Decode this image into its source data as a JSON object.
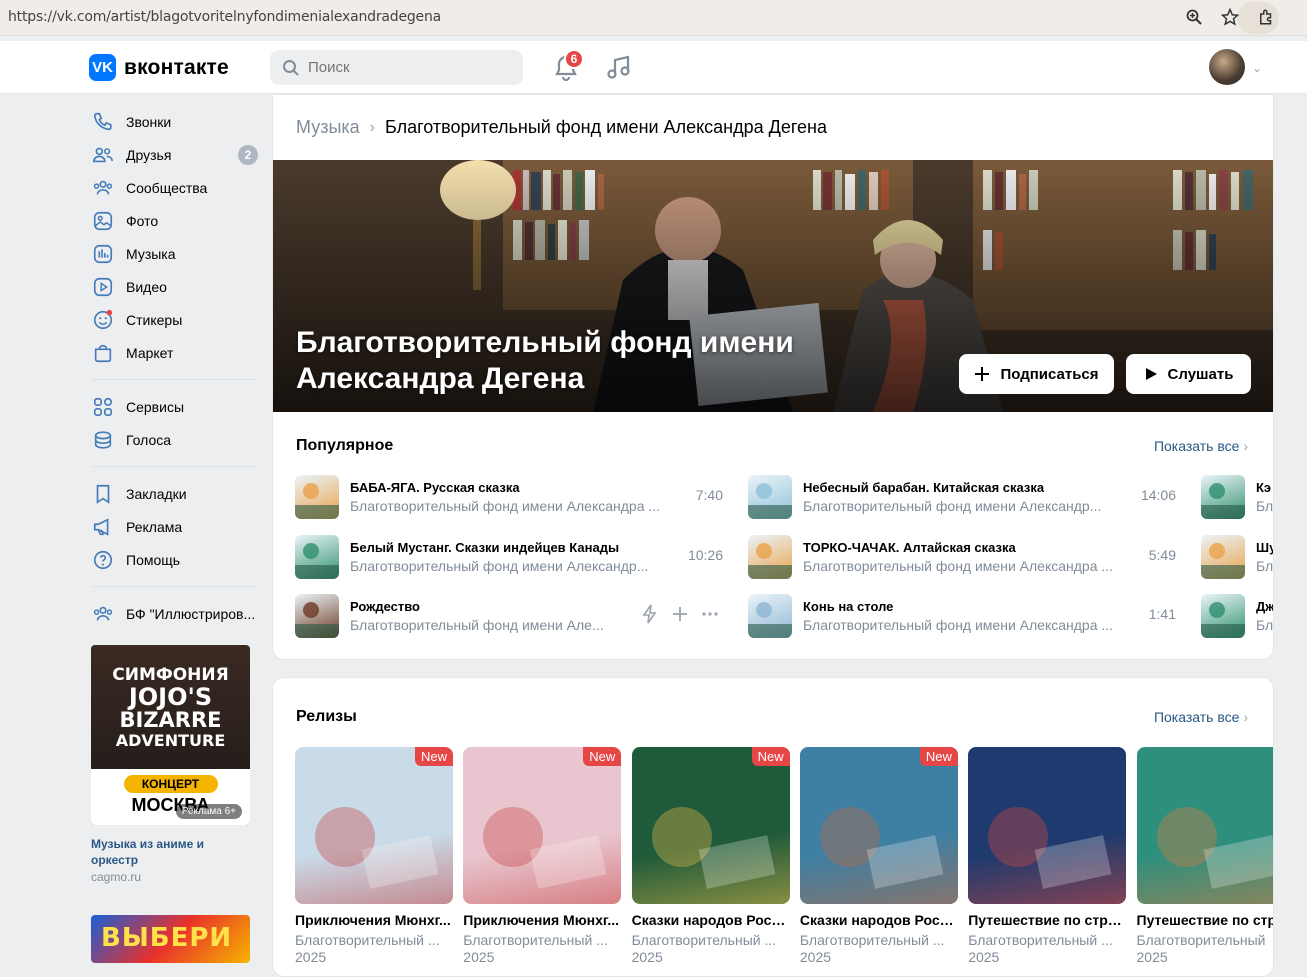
{
  "browser": {
    "url": "https://vk.com/artist/blagotvoritelnyfondimenialexandradegena"
  },
  "header": {
    "logo_text": "вконтакте",
    "search_placeholder": "Поиск",
    "notifications_count": "6"
  },
  "sidebar": {
    "items": [
      {
        "label": "Звонки",
        "icon": "phone-icon"
      },
      {
        "label": "Друзья",
        "icon": "friends-icon",
        "badge": "2"
      },
      {
        "label": "Сообщества",
        "icon": "communities-icon"
      },
      {
        "label": "Фото",
        "icon": "photo-icon"
      },
      {
        "label": "Музыка",
        "icon": "music-icon"
      },
      {
        "label": "Видео",
        "icon": "video-icon"
      },
      {
        "label": "Стикеры",
        "icon": "stickers-icon"
      },
      {
        "label": "Маркет",
        "icon": "market-icon"
      }
    ],
    "items2": [
      {
        "label": "Сервисы",
        "icon": "services-icon"
      },
      {
        "label": "Голоса",
        "icon": "votes-icon"
      }
    ],
    "items3": [
      {
        "label": "Закладки",
        "icon": "bookmark-icon"
      },
      {
        "label": "Реклама",
        "icon": "megaphone-icon"
      },
      {
        "label": "Помощь",
        "icon": "help-icon"
      }
    ],
    "group_label": "БФ \"Иллюстриров...",
    "ad1": {
      "line1": "СИМФОНИЯ",
      "line2": "JOJO'S",
      "line3": "BIZARRE",
      "line4": "ADVENTURE",
      "tag": "КОНЦЕРТ",
      "city": "МОСКВА",
      "label": "Реклама 6+",
      "text": "Музыка из аниме и оркестр",
      "url": "cagmo.ru"
    },
    "ad2_text": "ВЫБЕРИ"
  },
  "page": {
    "breadcrumb_root": "Музыка",
    "breadcrumb_current": "Благотворительный фонд имени Александра Дегена",
    "hero_title_line1": "Благотворительный фонд имени",
    "hero_title_line2": "Александра Дегена",
    "subscribe_label": "Подписаться",
    "listen_label": "Слушать"
  },
  "popular": {
    "title": "Популярное",
    "show_all": "Показать все",
    "tracks": [
      {
        "title": "БАБА-ЯГА. Русская сказка",
        "artist": "Благотворительный фонд имени Александра ...",
        "duration": "7:40",
        "color": "#e9a14a"
      },
      {
        "title": "Белый Мустанг. Сказки индейцев Канады",
        "artist": "Благотворительный фонд имени Александр...",
        "duration": "10:26",
        "color": "#2e8f6d"
      },
      {
        "title": "Рождество",
        "artist": "Благотворительный фонд имени Але...",
        "duration": "",
        "color": "#6b3a22"
      },
      {
        "title": "Небесный барабан. Китайская сказка",
        "artist": "Благотворительный фонд имени Александр...",
        "duration": "14:06",
        "color": "#8fc0d8"
      },
      {
        "title": "ТОРКО-ЧАЧАК. Алтайская сказка",
        "artist": "Благотворительный фонд имени Александра ...",
        "duration": "5:49",
        "color": "#e9a14a"
      },
      {
        "title": "Конь на столе",
        "artist": "Благотворительный фонд имени Александра ...",
        "duration": "1:41",
        "color": "#8fb6d4"
      },
      {
        "title": "Кэ",
        "artist": "Бл",
        "duration": "",
        "color": "#2e8f6d"
      },
      {
        "title": "Шу",
        "artist": "Бл",
        "duration": "",
        "color": "#e9a14a"
      },
      {
        "title": "Дж",
        "artist": "Бл",
        "duration": "",
        "color": "#2e8f6d"
      }
    ]
  },
  "releases": {
    "title": "Релизы",
    "show_all": "Показать все",
    "new_label": "New",
    "items": [
      {
        "title": "Приключения Мюнхг...",
        "artist": "Благотворительный ...",
        "year": "2025",
        "new": true,
        "bg": "#c9dbe8",
        "accent": "#c23a3a"
      },
      {
        "title": "Приключения Мюнхг...",
        "artist": "Благотворительный ...",
        "year": "2025",
        "new": true,
        "bg": "#e9c6cf",
        "accent": "#c23a3a"
      },
      {
        "title": "Сказки народов Росс...",
        "artist": "Благотворительный ...",
        "year": "2025",
        "new": true,
        "bg": "#1f5a3a",
        "accent": "#f2c14a"
      },
      {
        "title": "Сказки народов Росс...",
        "artist": "Благотворительный ...",
        "year": "2025",
        "new": true,
        "bg": "#3f7fa3",
        "accent": "#c86a3a"
      },
      {
        "title": "Путешествие по стра...",
        "artist": "Благотворительный ...",
        "year": "2025",
        "new": false,
        "bg": "#1e3a6e",
        "accent": "#e64a3a"
      },
      {
        "title": "Путешествие по стр",
        "artist": "Благотворительный",
        "year": "2025",
        "new": false,
        "bg": "#2e8f7d",
        "accent": "#e67a3a"
      }
    ]
  }
}
